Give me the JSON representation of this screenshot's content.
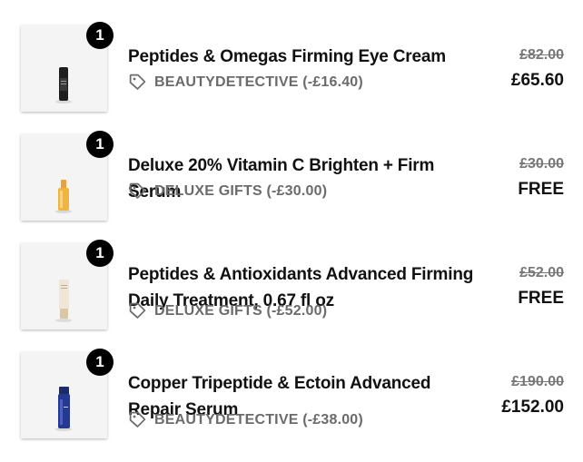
{
  "cart": {
    "items": [
      {
        "quantity": "1",
        "name": "Peptides & Omegas Firming Eye Cream",
        "promo": "BEAUTYDETECTIVE (-£16.40)",
        "original_price": "£82.00",
        "price": "£65.60"
      },
      {
        "quantity": "1",
        "name": "Deluxe 20% Vitamin C Brighten + Firm Serum",
        "promo": "DELUXE GIFTS (-£30.00)",
        "original_price": "£30.00",
        "price": "FREE"
      },
      {
        "quantity": "1",
        "name": "Peptides & Antioxidants Advanced Firming Daily Treatment, 0.67 fl oz",
        "promo": "DELUXE GIFTS (-£52.00)",
        "original_price": "£52.00",
        "price": "FREE"
      },
      {
        "quantity": "1",
        "name": "Copper Tripeptide & Ectoin Advanced Repair Serum",
        "promo": "BEAUTYDETECTIVE (-£38.00)",
        "original_price": "£190.00",
        "price": "£152.00"
      }
    ]
  },
  "icons": {
    "promo_tag": "tag-icon"
  },
  "colors": {
    "badge": "#000000",
    "promo_text": "#6b6b6b",
    "strike_price": "#777777"
  }
}
